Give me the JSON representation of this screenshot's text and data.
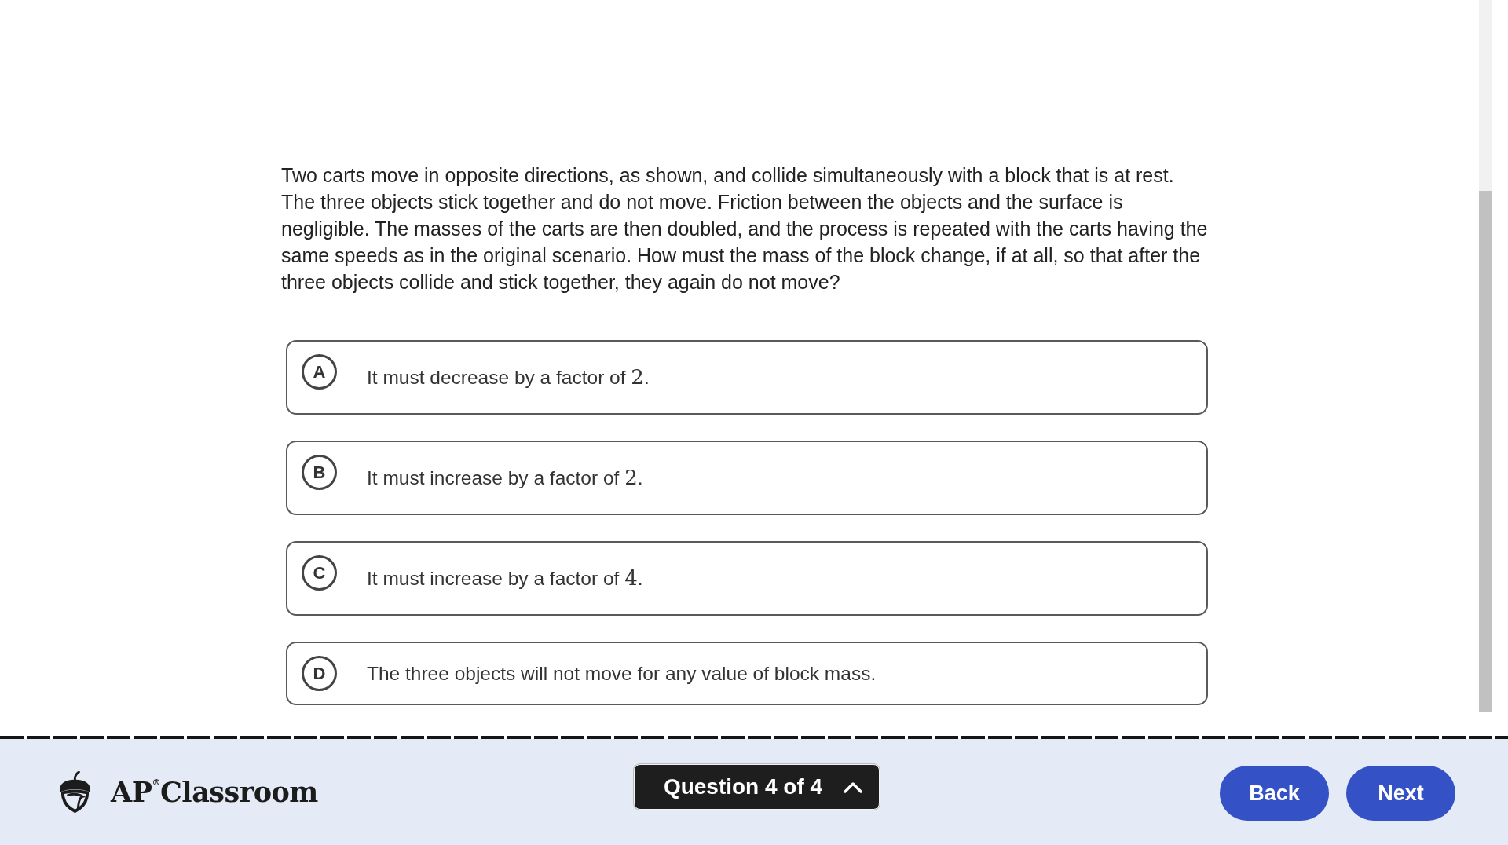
{
  "question": {
    "text": "Two carts move in opposite directions, as shown, and collide simultaneously with a block that is at rest. The three objects stick together and do not move. Friction between the objects and the surface is negligible. The masses of the carts are then doubled, and the process is repeated with the carts having the same speeds as in the original scenario. How must the mass of the block change, if at all, so that after the three objects collide and stick together, they again do not move?"
  },
  "options": [
    {
      "letter": "A",
      "selected": false,
      "parts": [
        {
          "kind": "text",
          "text": "It must decrease by a factor of "
        },
        {
          "kind": "math",
          "text": "2"
        },
        {
          "kind": "text",
          "text": "."
        }
      ]
    },
    {
      "letter": "B",
      "selected": false,
      "parts": [
        {
          "kind": "text",
          "text": "It must increase by a factor of "
        },
        {
          "kind": "math",
          "text": "2"
        },
        {
          "kind": "text",
          "text": "."
        }
      ]
    },
    {
      "letter": "C",
      "selected": false,
      "parts": [
        {
          "kind": "text",
          "text": "It must increase by a factor of "
        },
        {
          "kind": "math",
          "text": "4"
        },
        {
          "kind": "text",
          "text": "."
        }
      ]
    },
    {
      "letter": "D",
      "selected": false,
      "parts": [
        {
          "kind": "text",
          "text": "The three objects will not move for any value of block mass."
        }
      ]
    }
  ],
  "footer": {
    "logo": "AP$^{®}$Classroom",
    "question_nav": {
      "label": "Question 4 of 4"
    },
    "buttons": [
      {
        "label": "Back"
      },
      {
        "label": "Next"
      }
    ]
  }
}
